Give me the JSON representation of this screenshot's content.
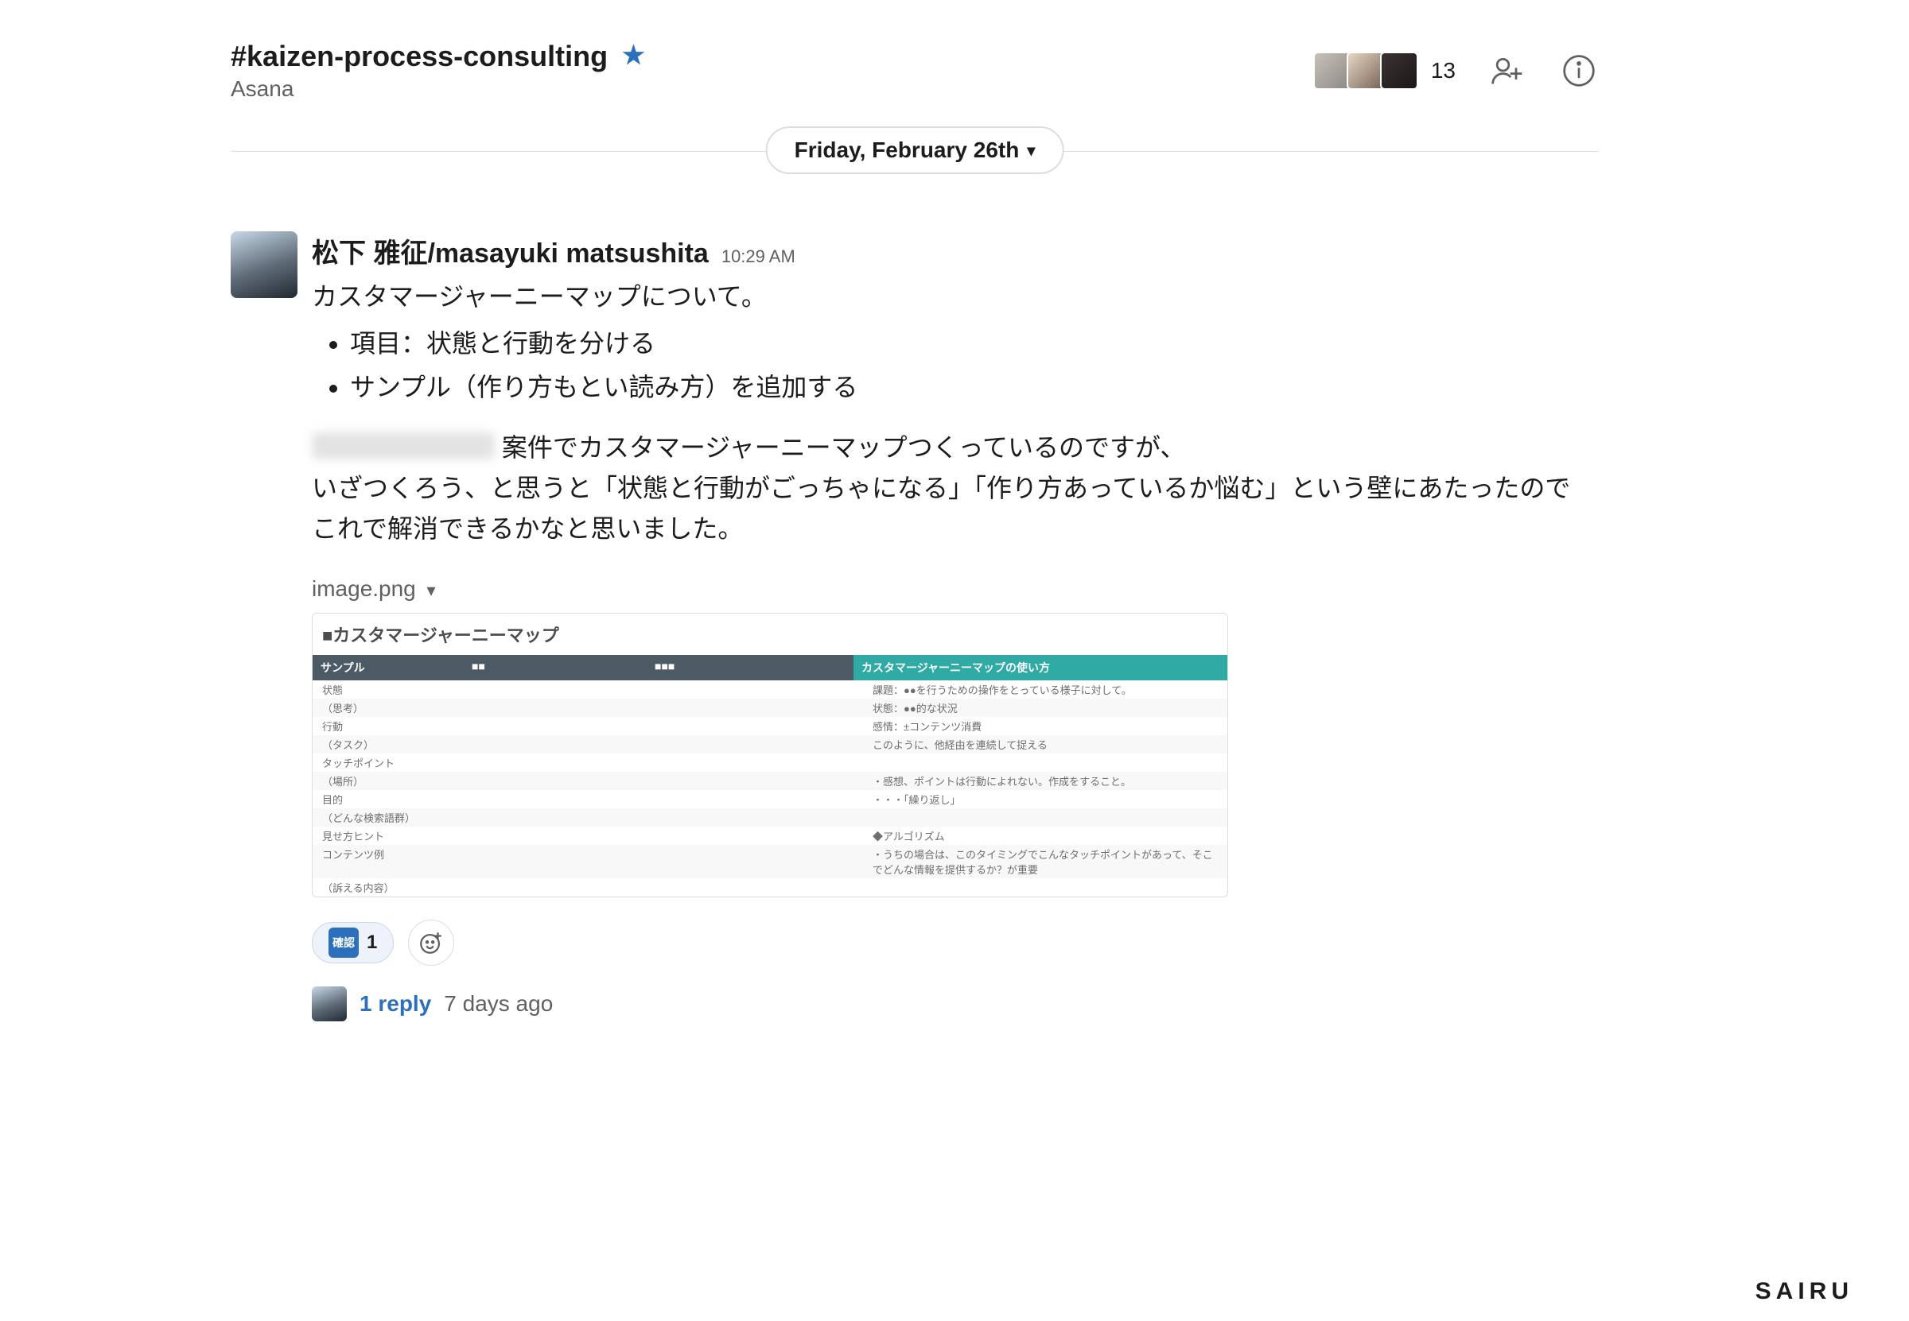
{
  "header": {
    "channel": "#kaizen-process-consulting",
    "subtitle": "Asana",
    "member_count": "13"
  },
  "date_divider": "Friday, February 26th",
  "message": {
    "sender": "松下 雅征/masayuki matsushita",
    "time": "10:29 AM",
    "line0": "カスタマージャーニーマップについて。",
    "bullets": [
      "項目：状態と行動を分ける",
      "サンプル（作り方もとい読み方）を追加する"
    ],
    "para1a": "案件でカスタマージャーニーマップつくっているのですが、",
    "para2": "いざつくろう、と思うと「状態と行動がごっちゃになる」「作り方あっているか悩む」という壁にあたったので",
    "para3": "これで解消できるかなと思いました。"
  },
  "attachment": {
    "filename": "image.png",
    "title": "■カスタマージャーニーマップ",
    "head": {
      "c1": "サンプル",
      "c2": "■■",
      "c3": "■■■",
      "c4": "カスタマージャーニーマップの使い方"
    },
    "rows": [
      {
        "c1": "状態",
        "c4": "課題：●●を行うための操作をとっている様子に対して。"
      },
      {
        "c1": "（思考）",
        "c4": "状態：●●的な状況"
      },
      {
        "c1": "行動",
        "c4": "感情：±コンテンツ消費"
      },
      {
        "c1": "（タスク）",
        "c4": "このように、他経由を連続して捉える"
      },
      {
        "c1": "タッチポイント",
        "c4": ""
      },
      {
        "c1": "（場所）",
        "c4": "・感想、ポイントは行動によれない。作成をすること。"
      },
      {
        "c1": "目的",
        "c4": "・・・「繰り返し」"
      },
      {
        "c1": "（どんな検索語群）",
        "c4": ""
      },
      {
        "c1": "見せ方ヒント",
        "c4": "◆アルゴリズム"
      },
      {
        "c1": "コンテンツ例",
        "c4": "・うちの場合は、このタイミングでこんなタッチポイントがあって、そこでどんな情報を提供するか？が重要"
      },
      {
        "c1": "（訴える内容）",
        "c4": ""
      }
    ]
  },
  "reactions": {
    "kakunin_count": "1"
  },
  "thread": {
    "reply_label": "1 reply",
    "ago": "7 days ago"
  },
  "brand": "SAIRU"
}
